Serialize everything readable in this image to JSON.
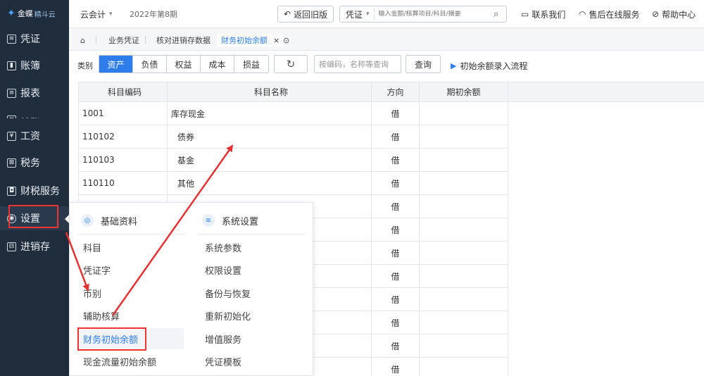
{
  "sidebar": {
    "logo": {
      "brand": "金蝶",
      "product": "精斗云"
    },
    "items": [
      {
        "label": "凭证",
        "icon": "document-icon"
      },
      {
        "label": "账簿",
        "icon": "book-icon"
      },
      {
        "label": "报表",
        "icon": "report-icon"
      },
      {
        "label": "结账",
        "icon": "checkout-icon"
      },
      {
        "label": "工资",
        "icon": "yen-icon"
      },
      {
        "label": "税务",
        "icon": "tax-icon"
      },
      {
        "label": "财税服务",
        "icon": "service-icon"
      },
      {
        "label": "设置",
        "icon": "gear-icon"
      },
      {
        "label": "进销存",
        "icon": "inventory-icon"
      }
    ]
  },
  "topbar": {
    "account": "云会计",
    "period": "2022年第8期",
    "back_label": "返回旧版",
    "search_type": "凭证",
    "search_placeholder": "输入金额/核算项目/科目/摘要",
    "contact": "联系我们",
    "service": "售后在线服务",
    "help": "帮助中心"
  },
  "tabs": [
    {
      "label": "业务凭证"
    },
    {
      "label": "核对进销存数据"
    },
    {
      "label": "财务初始余额",
      "close": "×"
    }
  ],
  "category": {
    "label": "类别",
    "options": [
      "资产",
      "负债",
      "权益",
      "成本",
      "损益"
    ],
    "search_placeholder": "按编码，名称等查询",
    "query_label": "查询",
    "flow_link": "初始余额录入流程"
  },
  "table": {
    "headers": [
      "科目编码",
      "科目名称",
      "方向",
      "期初余额"
    ],
    "rows": [
      {
        "code": "1001",
        "name": "库存现金",
        "dir": "借"
      },
      {
        "code": "110102",
        "name": "债券",
        "dir": "借"
      },
      {
        "code": "110103",
        "name": "基金",
        "dir": "借"
      },
      {
        "code": "110110",
        "name": "其他",
        "dir": "借"
      },
      {
        "code": "",
        "name": "",
        "dir": "借"
      },
      {
        "code": "",
        "name": "",
        "dir": "借"
      },
      {
        "code": "",
        "name": "",
        "dir": "借"
      },
      {
        "code": "",
        "name": "",
        "dir": "借"
      },
      {
        "code": "",
        "name": "",
        "dir": "借"
      },
      {
        "code": "",
        "name": "",
        "dir": "借"
      },
      {
        "code": "",
        "name": "",
        "dir": "借"
      },
      {
        "code": "",
        "name": "",
        "dir": "借"
      }
    ]
  },
  "popup": {
    "col1": {
      "title": "基础资料",
      "items": [
        "科目",
        "凭证字",
        "币别",
        "辅助核算",
        "财务初始余额",
        "现金流量初始余额"
      ]
    },
    "col2": {
      "title": "系统设置",
      "items": [
        "系统参数",
        "权限设置",
        "备份与恢复",
        "重新初始化",
        "增值服务",
        "凭证模板"
      ]
    }
  },
  "colors": {
    "accent": "#2f7dea",
    "sidebar_bg": "#1f2d3d",
    "highlight": "#e33333"
  }
}
